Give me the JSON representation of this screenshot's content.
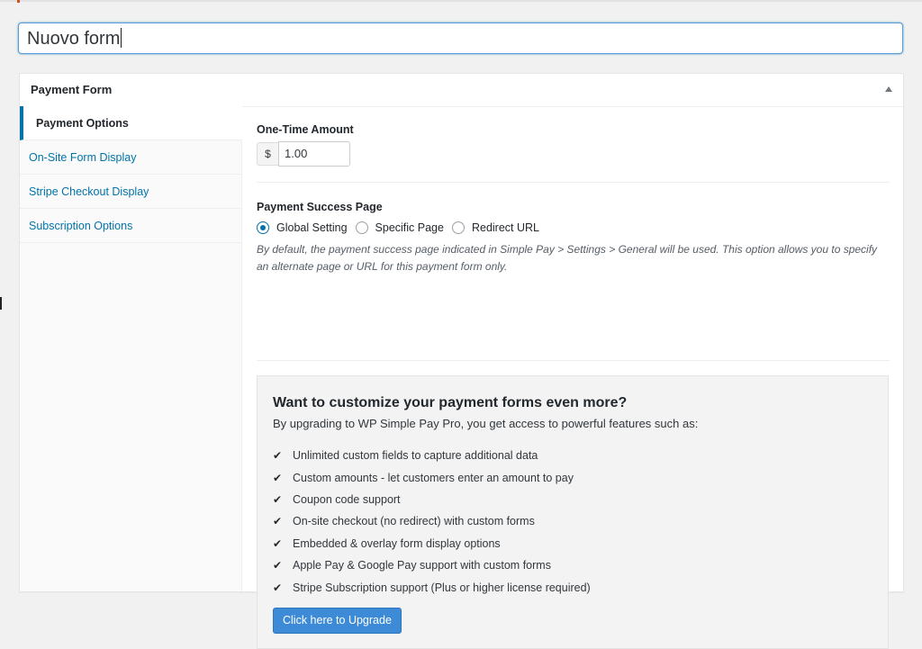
{
  "title_input": {
    "value": "Nuovo form"
  },
  "metabox": {
    "title": "Payment Form",
    "tabs": [
      {
        "label": "Payment Options",
        "active": true
      },
      {
        "label": "On-Site Form Display",
        "active": false
      },
      {
        "label": "Stripe Checkout Display",
        "active": false
      },
      {
        "label": "Subscription Options",
        "active": false
      }
    ]
  },
  "payment_options": {
    "amount_label": "One-Time Amount",
    "currency_symbol": "$",
    "amount_value": "1.00",
    "success_page_label": "Payment Success Page",
    "success_options": [
      {
        "label": "Global Setting",
        "checked": true
      },
      {
        "label": "Specific Page",
        "checked": false
      },
      {
        "label": "Redirect URL",
        "checked": false
      }
    ],
    "success_description": "By default, the payment success page indicated in Simple Pay > Settings > General will be used. This option allows you to specify an alternate page or URL for this payment form only."
  },
  "upsell": {
    "title": "Want to customize your payment forms even more?",
    "intro": "By upgrading to WP Simple Pay Pro, you get access to powerful features such as:",
    "check_glyph": "✔",
    "features": [
      "Unlimited custom fields to capture additional data",
      "Custom amounts - let customers enter an amount to pay",
      "Coupon code support",
      "On-site checkout (no redirect) with custom forms",
      "Embedded & overlay form display options",
      "Apple Pay & Google Pay support with custom forms",
      "Stripe Subscription support (Plus or higher license required)"
    ],
    "button_label": "Click here to Upgrade"
  },
  "colors": {
    "link": "#0073aa",
    "button": "#3d8ad6",
    "focus_border": "#5b9dd9"
  }
}
